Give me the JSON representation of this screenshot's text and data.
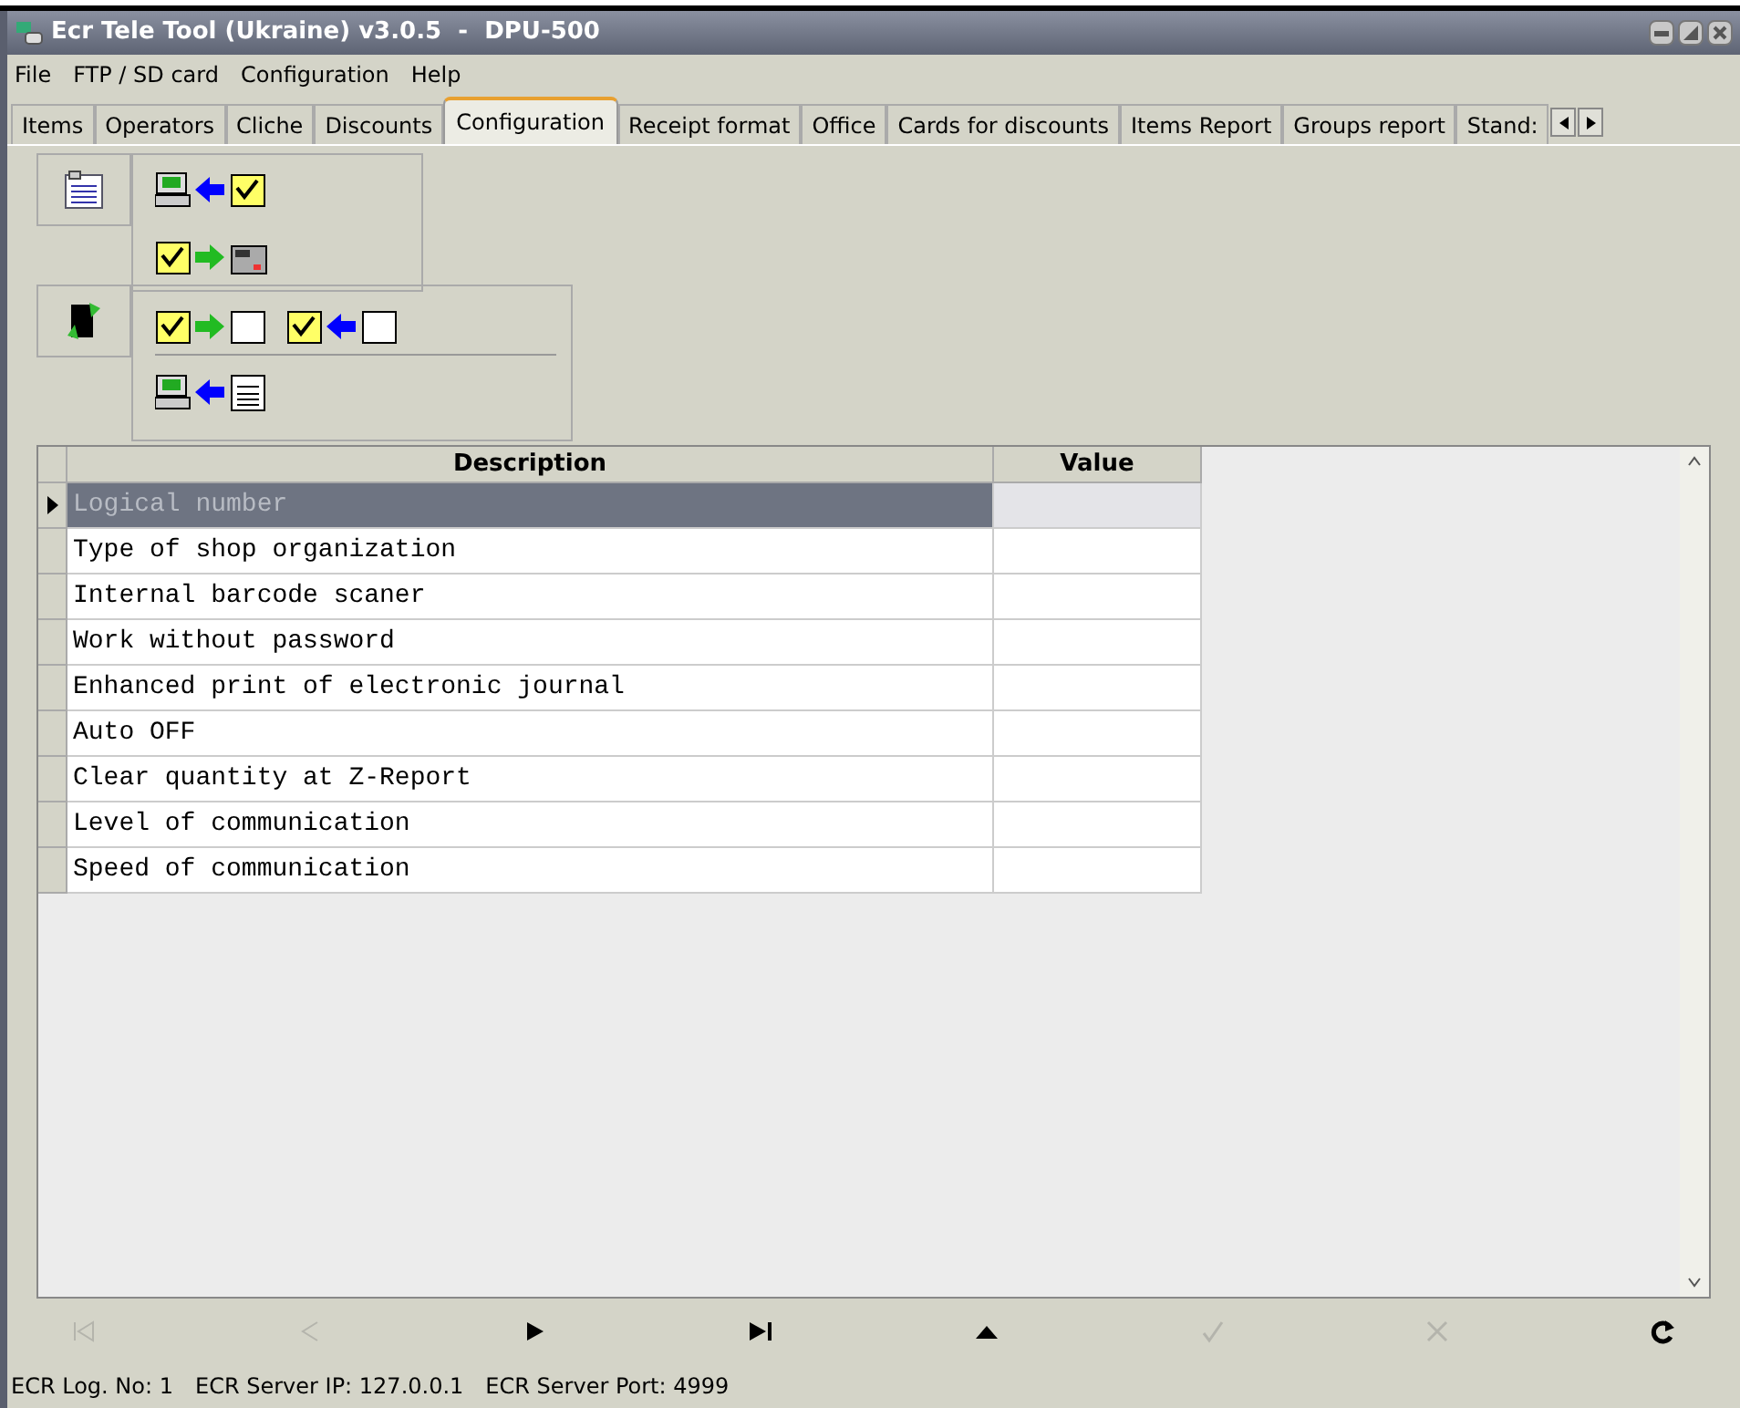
{
  "window": {
    "title": "Ecr Tele Tool (Ukraine) v3.0.5  -  DPU-500"
  },
  "menu": [
    "File",
    "FTP / SD card",
    "Configuration",
    "Help"
  ],
  "tabs": [
    {
      "label": "Items",
      "selected": false
    },
    {
      "label": "Operators",
      "selected": false
    },
    {
      "label": "Cliche",
      "selected": false
    },
    {
      "label": "Discounts",
      "selected": false
    },
    {
      "label": "Configuration",
      "selected": true
    },
    {
      "label": "Receipt format",
      "selected": false
    },
    {
      "label": "Office",
      "selected": false
    },
    {
      "label": "Cards for discounts",
      "selected": false
    },
    {
      "label": "Items Report",
      "selected": false
    },
    {
      "label": "Groups report",
      "selected": false
    },
    {
      "label": "Stand:",
      "selected": false
    }
  ],
  "table": {
    "columns": [
      "Description",
      "Value"
    ],
    "rows": [
      {
        "description": "Logical number",
        "selected": true
      },
      {
        "description": "Type of shop organization",
        "selected": false
      },
      {
        "description": "Internal barcode scaner",
        "selected": false
      },
      {
        "description": "Work without password",
        "selected": false
      },
      {
        "description": "Enhanced print of electronic journal",
        "selected": false
      },
      {
        "description": "Auto OFF",
        "selected": false
      },
      {
        "description": "Clear quantity at Z-Report",
        "selected": false
      },
      {
        "description": "Level of communication",
        "selected": false
      },
      {
        "description": "Speed of communication",
        "selected": false
      }
    ]
  },
  "navigator": [
    {
      "kind": "first",
      "disabled": true
    },
    {
      "kind": "prior",
      "disabled": true
    },
    {
      "kind": "next",
      "disabled": false
    },
    {
      "kind": "last",
      "disabled": false
    },
    {
      "kind": "insert",
      "disabled": false
    },
    {
      "kind": "post",
      "disabled": true
    },
    {
      "kind": "cancel",
      "disabled": true
    },
    {
      "kind": "refresh",
      "disabled": false
    }
  ],
  "status_bar": [
    "ECR Log. No: 1",
    "ECR Server IP: 127.0.0.1",
    "ECR Server Port: 4999"
  ]
}
